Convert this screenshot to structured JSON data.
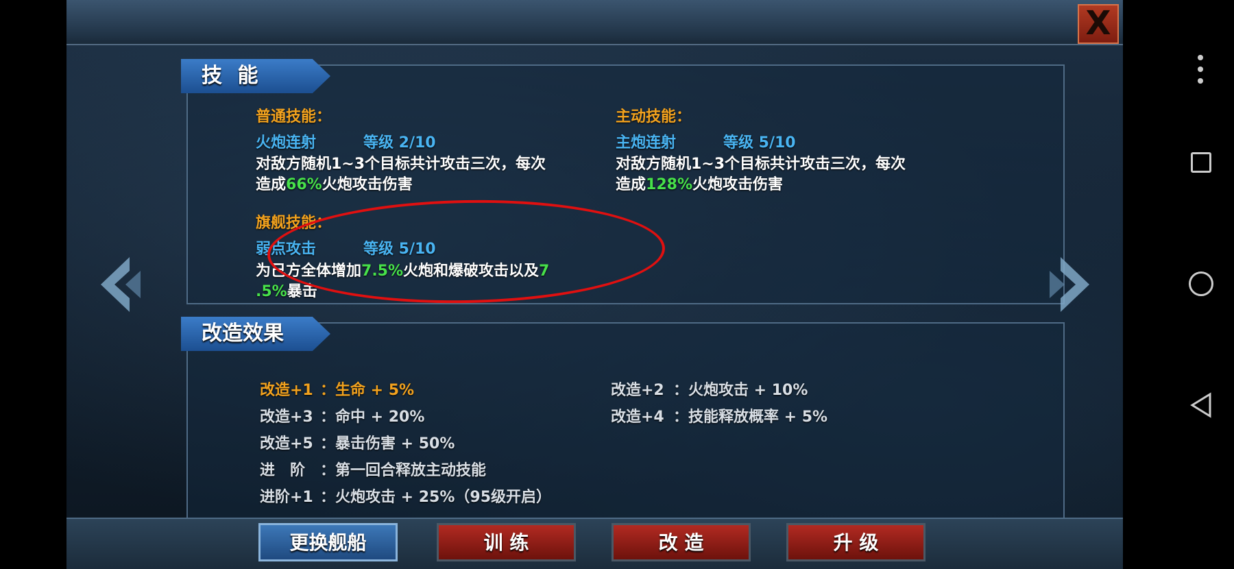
{
  "close_label": "X",
  "skills": {
    "tab_title": "技 能",
    "normal": {
      "heading": "普通技能：",
      "name": "火炮连射",
      "level": "等级 2/10",
      "desc_pre": "对敌方随机1~3个目标共计攻击三次，每次",
      "desc_line2_pre": "造成",
      "highlight": "66%",
      "desc_post": "火炮攻击伤害"
    },
    "active": {
      "heading": "主动技能：",
      "name": "主炮连射",
      "level": "等级 5/10",
      "desc_pre": "对敌方随机1~3个目标共计攻击三次，每次",
      "desc_line2_pre": "造成",
      "highlight": "128%",
      "desc_post": "火炮攻击伤害"
    },
    "flagship": {
      "heading": "旗舰技能：",
      "name": "弱点攻击",
      "level": "等级 5/10",
      "desc_pre": "为己方全体增加",
      "highlight1": "7.5%",
      "desc_mid": "火炮和爆破攻击以及",
      "highlight2a": "7",
      "highlight2b": ".5%",
      "desc_post": "暴击"
    }
  },
  "refit": {
    "tab_title": "改造效果",
    "items": [
      {
        "label": "改造+1",
        "value": "：生命 + 5%"
      },
      {
        "label": "改造+2",
        "value": "：火炮攻击 + 10%"
      },
      {
        "label": "改造+3",
        "value": "：命中 + 20%"
      },
      {
        "label": "改造+4",
        "value": "：技能释放概率 + 5%"
      },
      {
        "label": "改造+5",
        "value": "：暴击伤害 + 50%"
      },
      {
        "label": "进　阶",
        "value": "：第一回合释放主动技能"
      },
      {
        "label": "进阶+1",
        "value": "：火炮攻击 + 25%（95级开启）"
      }
    ]
  },
  "buttons": {
    "change_ship": "更换舰船",
    "train": "训 练",
    "refit": "改 造",
    "upgrade": "升 级"
  },
  "colors": {
    "orange": "#f2a21e",
    "blue": "#49b4f2",
    "green": "#47e14a",
    "red_circle": "#e01010"
  }
}
